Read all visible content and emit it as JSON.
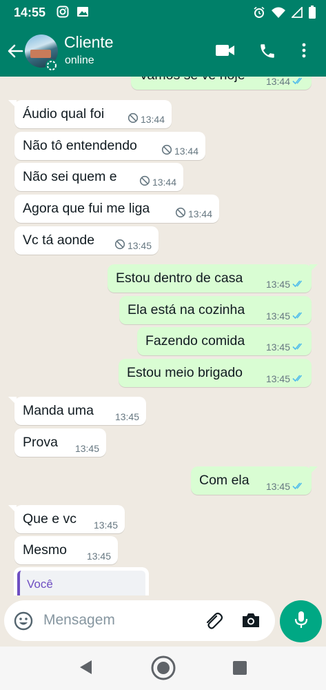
{
  "status_bar": {
    "time": "14:55"
  },
  "header": {
    "contact_name": "Cliente",
    "contact_status": "online"
  },
  "messages": [
    {
      "text": "Vamos se ve hoje",
      "time": "13:44",
      "dir": "out",
      "state": "read",
      "partial": true
    },
    {
      "text": "Áudio qual foi",
      "time": "13:44",
      "dir": "in",
      "deleted_icon": true,
      "tail": true
    },
    {
      "text": "Não tô entendendo",
      "time": "13:44",
      "dir": "in",
      "deleted_icon": true
    },
    {
      "text": "Não sei quem e",
      "time": "13:44",
      "dir": "in",
      "deleted_icon": true
    },
    {
      "text": "Agora que fui me liga",
      "time": "13:44",
      "dir": "in",
      "deleted_icon": true
    },
    {
      "text": "Vc tá aonde",
      "time": "13:45",
      "dir": "in",
      "deleted_icon": true
    },
    {
      "text": "Estou dentro de casa",
      "time": "13:45",
      "dir": "out",
      "state": "read",
      "tail": true
    },
    {
      "text": "Ela está na cozinha",
      "time": "13:45",
      "dir": "out",
      "state": "read"
    },
    {
      "text": "Fazendo comida",
      "time": "13:45",
      "dir": "out",
      "state": "read"
    },
    {
      "text": "Estou meio brigado",
      "time": "13:45",
      "dir": "out",
      "state": "read"
    },
    {
      "text": "Manda uma",
      "time": "13:45",
      "dir": "in",
      "tail": true
    },
    {
      "text": "Prova",
      "time": "13:45",
      "dir": "in"
    },
    {
      "text": "Com ela",
      "time": "13:45",
      "dir": "out",
      "state": "read",
      "tail": true
    },
    {
      "text": "Que e vc",
      "time": "13:45",
      "dir": "in",
      "tail": true
    },
    {
      "text": "Mesmo",
      "time": "13:45",
      "dir": "in"
    }
  ],
  "reply_preview": {
    "author": "Você"
  },
  "composer": {
    "placeholder": "Mensagem"
  },
  "colors": {
    "header": "#008069",
    "outgoing": "#d9fdd3",
    "incoming": "#ffffff",
    "read_ticks": "#53bdeb",
    "mic": "#00a884",
    "background": "#efeae2"
  }
}
